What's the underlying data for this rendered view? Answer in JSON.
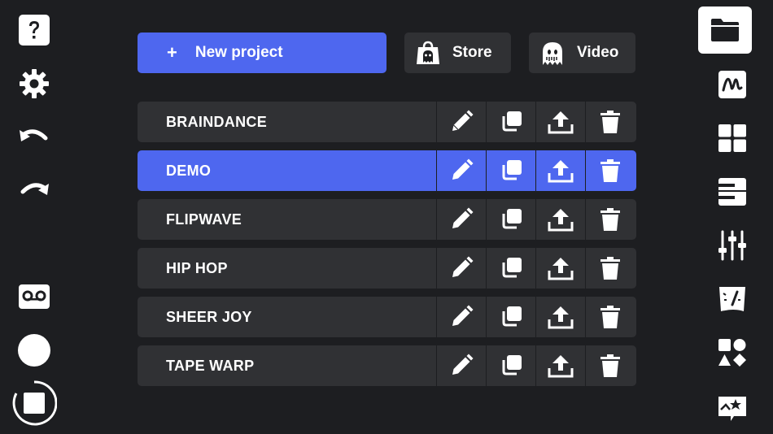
{
  "left_toolbar": {
    "items": [
      {
        "name": "help-icon"
      },
      {
        "name": "settings-gear-icon"
      },
      {
        "name": "undo-icon"
      },
      {
        "name": "redo-icon"
      },
      {
        "name": "cassette-tape-icon"
      },
      {
        "name": "record-button-icon"
      },
      {
        "name": "stop-button-icon"
      }
    ]
  },
  "top_actions": {
    "new_project": {
      "plus": "+",
      "label": "New project"
    },
    "store": {
      "label": "Store",
      "icon": "shopping-bag-ghost-icon"
    },
    "video": {
      "label": "Video",
      "icon": "ghost-icon"
    }
  },
  "projects": [
    {
      "name": "BRAINDANCE",
      "selected": false
    },
    {
      "name": "DEMO",
      "selected": true
    },
    {
      "name": "FLIPWAVE",
      "selected": false
    },
    {
      "name": "HIP HOP",
      "selected": false
    },
    {
      "name": "SHEER JOY",
      "selected": false
    },
    {
      "name": "TAPE WARP",
      "selected": false
    }
  ],
  "row_actions": [
    "pencil-icon",
    "duplicate-icon",
    "export-upload-icon",
    "trash-icon"
  ],
  "right_toolbar": {
    "active": "projects-folder-icon",
    "items": [
      {
        "name": "projects-folder-icon"
      },
      {
        "name": "waveform-icon"
      },
      {
        "name": "pad-grid-icon"
      },
      {
        "name": "piano-keys-icon"
      },
      {
        "name": "mixer-sliders-icon"
      },
      {
        "name": "tempo-meter-icon"
      },
      {
        "name": "shapes-icon"
      },
      {
        "name": "effects-star-icon"
      }
    ]
  },
  "colors": {
    "background": "#1d1e21",
    "panel": "#303134",
    "accent": "#4e67ef",
    "icon": "#ffffff"
  }
}
